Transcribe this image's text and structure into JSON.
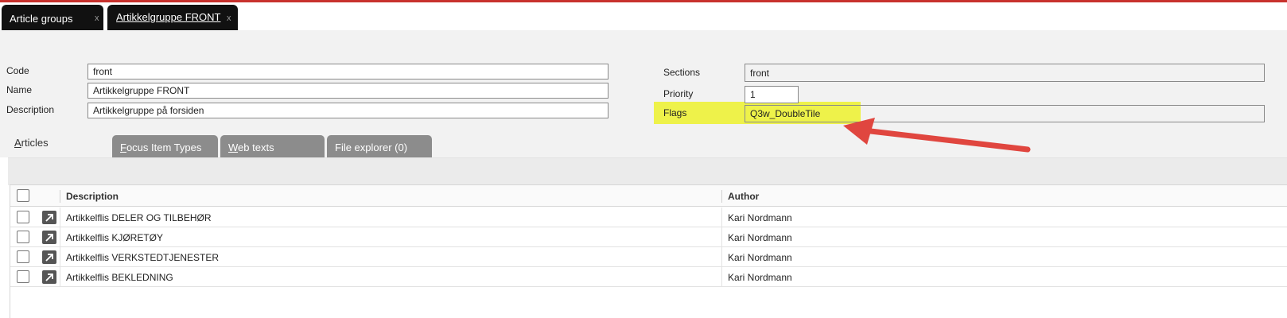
{
  "window": {
    "accent_color": "#c8312d",
    "tabs": [
      {
        "label": "Article groups",
        "close": "x",
        "active": false
      },
      {
        "label": "Artikkelgruppe FRONT",
        "close": "x",
        "active": true
      }
    ]
  },
  "form": {
    "code_label": "Code",
    "code_value": "front",
    "name_label": "Name",
    "name_value": "Artikkelgruppe FRONT",
    "description_label": "Description",
    "description_value": "Artikkelgruppe på forsiden",
    "sections_label": "Sections",
    "sections_value": "front",
    "priority_label": "Priority",
    "priority_value": "1",
    "flags_label": "Flags",
    "flags_value": "Q3w_DoubleTile",
    "highlight_color": "#eef24a",
    "annotation_arrow_color": "#e0463f"
  },
  "subtabs": [
    {
      "label": "Articles",
      "mnemonic": "A",
      "rest": "rticles",
      "active": true
    },
    {
      "label": "Focus Item Types",
      "mnemonic": "F",
      "rest": "ocus Item Types",
      "active": false
    },
    {
      "label": "Web texts",
      "mnemonic": "W",
      "rest": "eb texts",
      "active": false
    },
    {
      "label": "File explorer (0)",
      "mnemonic": "",
      "rest": "File explorer (0)",
      "active": false
    }
  ],
  "grid": {
    "columns": [
      "Description",
      "Author"
    ],
    "rows": [
      {
        "description": "Artikkelflis DELER OG TILBEHØR",
        "author": "Kari Nordmann"
      },
      {
        "description": "Artikkelflis KJØRETØY",
        "author": "Kari Nordmann"
      },
      {
        "description": "Artikkelflis VERKSTEDTJENESTER",
        "author": "Kari Nordmann"
      },
      {
        "description": "Artikkelflis BEKLEDNING",
        "author": "Kari Nordmann"
      }
    ]
  },
  "icons": [
    "close-icon",
    "checkbox-icon",
    "open-arrow-icon",
    "annotation-arrow-icon"
  ]
}
